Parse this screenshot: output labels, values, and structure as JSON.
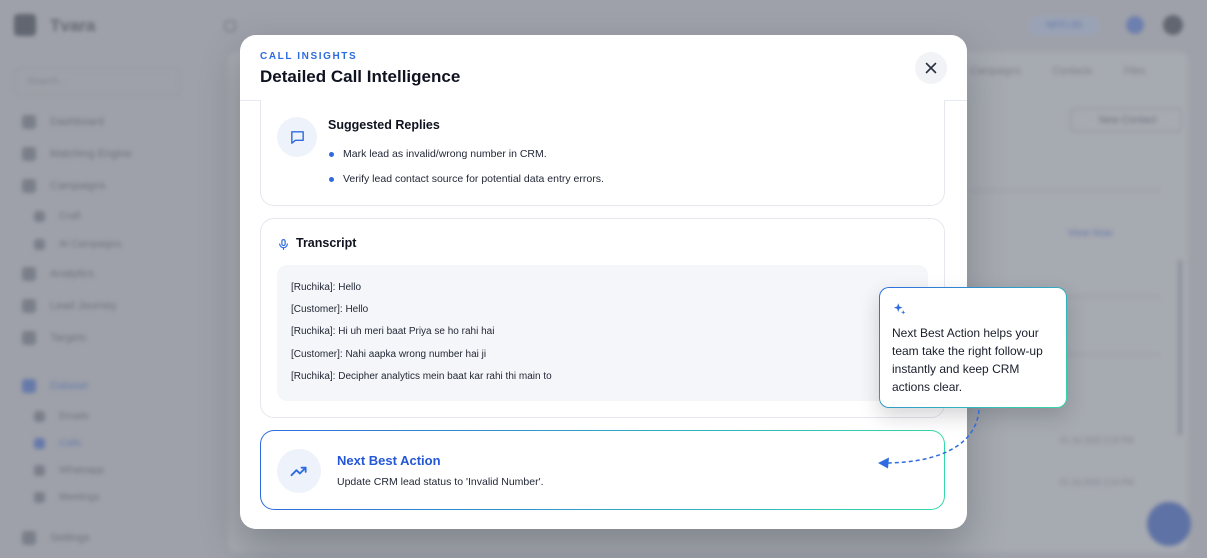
{
  "background": {
    "brand": "Tvara",
    "search_placeholder": "Search...",
    "nav": [
      "Dashboard",
      "Matching Engine",
      "Campaigns",
      "Craft",
      "AI Campaigns",
      "Analytics",
      "Lead Journey",
      "Targets",
      "Dataset",
      "Emails",
      "Calls",
      "Whatsapp",
      "Meetings",
      "Settings"
    ],
    "credits": "NFFI.00",
    "tabs": [
      "Campaigns",
      "Contacts",
      "Files"
    ],
    "new_button": "New Contact",
    "row_link": "View Now",
    "dates": [
      "01 Jul 2025 2:24 PM",
      "01 Jul 2025 2:24 PM"
    ]
  },
  "modal": {
    "eyebrow": "CALL INSIGHTS",
    "title": "Detailed Call Intelligence",
    "close_icon": "close-icon",
    "suggested": {
      "heading": "Suggested Replies",
      "icon": "message-square-icon",
      "items": [
        "Mark lead as invalid/wrong number in CRM.",
        "Verify lead contact source for potential data entry errors."
      ]
    },
    "transcript": {
      "heading": "Transcript",
      "icon": "mic-icon",
      "lines": [
        "[Ruchika]: Hello",
        "[Customer]: Hello",
        "[Ruchika]: Hi uh meri baat Priya se ho rahi hai",
        "[Customer]: Nahi aapka wrong number hai ji",
        "[Ruchika]: Decipher analytics mein baat kar rahi thi main to"
      ]
    },
    "next_best_action": {
      "title": "Next Best Action",
      "text": "Update CRM lead status to 'Invalid Number'.",
      "icon": "trending-up-icon"
    }
  },
  "callout": {
    "icon": "sparkle-icon",
    "text": "Next Best Action helps your team take the right follow-up instantly and keep CRM actions clear."
  },
  "colors": {
    "accent": "#2f6be0",
    "gradient_end": "#34d9a8",
    "title": "#0f1320"
  }
}
